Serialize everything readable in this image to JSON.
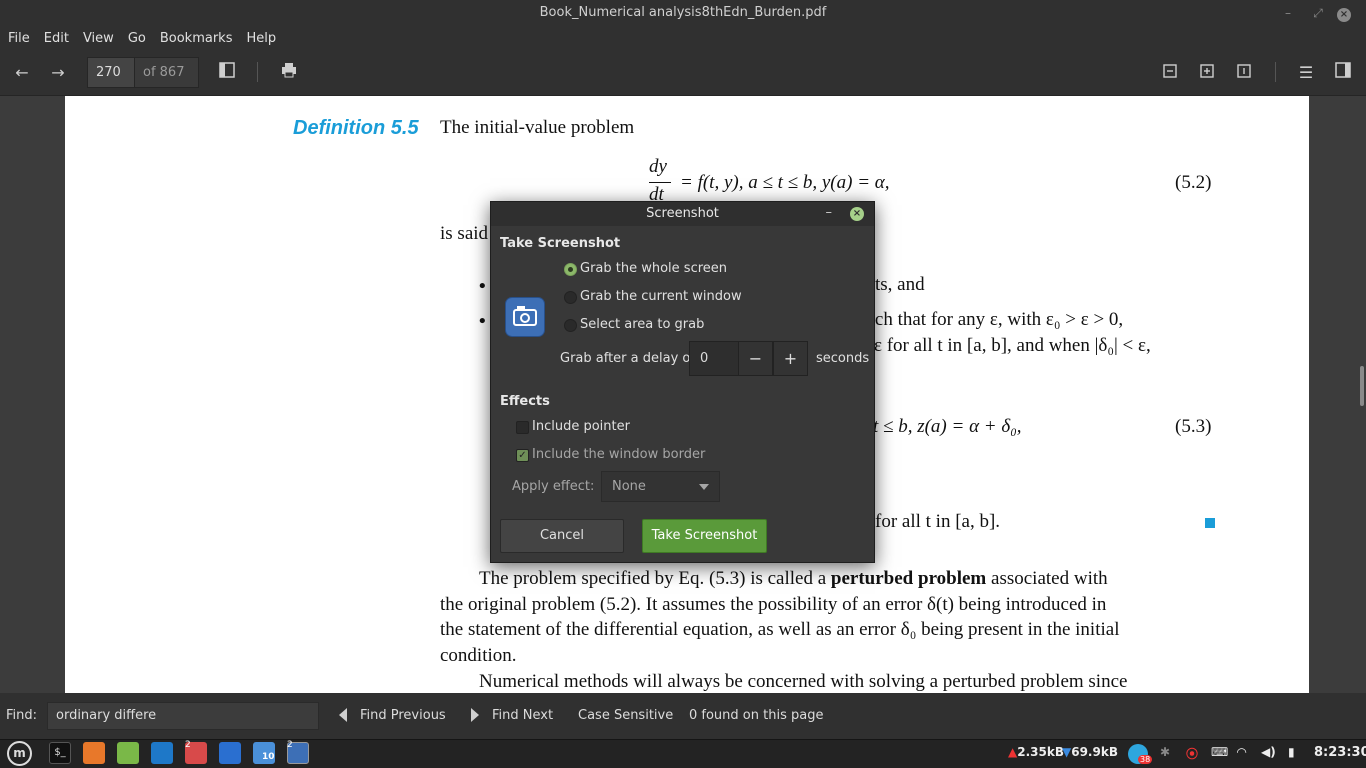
{
  "window": {
    "title": "Book_Numerical analysis8thEdn_Burden.pdf"
  },
  "menu": [
    "File",
    "Edit",
    "View",
    "Go",
    "Bookmarks",
    "Help"
  ],
  "toolbar": {
    "page_current": "270",
    "page_total": "of 867"
  },
  "document": {
    "definition_label": "Definition 5.5",
    "intro": "The initial-value problem",
    "eq52_lhs_num": "dy",
    "eq52_lhs_den": "dt",
    "eq52_rhs": "= f(t, y),     a ≤ t ≤ b,     y(a) = α,",
    "eq52_num": "(5.2)",
    "is_said": "is said",
    "bullet1_tail": "ts, and",
    "bullet2_line1": "such that for any ε, with ε₀ > ε > 0,",
    "bullet2_line2": "ε for all t in [a, b], and when |δ₀| < ε,",
    "eq53_rhs": "t ≤ b,    z(a) = α + δ₀,",
    "eq53_num": "(5.3)",
    "for_all": "for all t in [a, b].",
    "para1_l1_a": "The problem specified by Eq. (5.3) is called a ",
    "para1_l1_bold": "perturbed problem",
    "para1_l1_b": " associated with",
    "para1_l2": "the original problem (5.2). It assumes the possibility of an error δ(t) being introduced in",
    "para1_l3": "the statement of the differential equation, as well as an error δ₀ being present in the initial",
    "para1_l4": "condition.",
    "para2_l1": "Numerical methods will always be concerned with solving a perturbed problem since"
  },
  "find": {
    "label": "Find:",
    "value": "ordinary differe",
    "previous": "Find Previous",
    "next": "Find Next",
    "case": "Case Sensitive",
    "status": "0 found on this page"
  },
  "dialog": {
    "title": "Screenshot",
    "take_section": "Take Screenshot",
    "options": [
      "Grab the whole screen",
      "Grab the current window",
      "Select area to grab"
    ],
    "selected_option": "Grab the whole screen",
    "delay_label": "Grab after a delay of",
    "delay_value": "0",
    "delay_unit": "seconds",
    "effects_section": "Effects",
    "include_pointer": "Include pointer",
    "include_border": "Include the window border",
    "apply_effect_label": "Apply effect:",
    "apply_effect_value": "None",
    "cancel": "Cancel",
    "take": "Take Screenshot"
  },
  "taskbar": {
    "upload": "2.35kB",
    "download": "69.9kB",
    "clock": "8:23:30",
    "telegram_badge": "38",
    "badges": [
      "2",
      "2"
    ],
    "app_badge": "10"
  },
  "colors": {
    "accent_blue": "#1a9dd8",
    "take_button": "#5a9a3a",
    "radio_selected": "#8cb86a"
  }
}
